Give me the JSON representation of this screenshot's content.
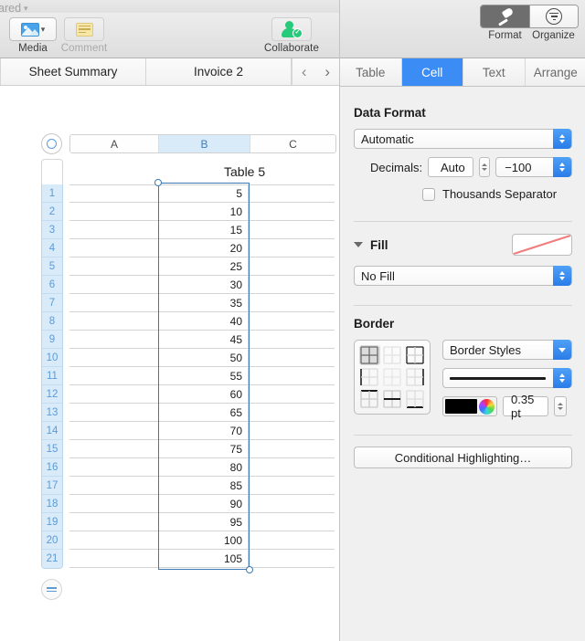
{
  "window": {
    "shared_label": "ared",
    "shared_icon": "chevron-down-icon"
  },
  "toolbar": {
    "items": [
      {
        "label": "Media",
        "icon": "media-image-icon",
        "enabled": true
      },
      {
        "label": "Comment",
        "icon": "comment-note-icon",
        "enabled": false
      },
      {
        "label": "Collaborate",
        "icon": "collaborate-person-check-icon",
        "enabled": true
      }
    ]
  },
  "sheet_tabs": {
    "tabs": [
      "Sheet Summary",
      "Invoice 2"
    ],
    "prev_icon": "chevron-left-icon",
    "next_icon": "chevron-right-icon"
  },
  "canvas": {
    "table_name": "Table 5",
    "columns": [
      "A",
      "B",
      "C"
    ],
    "selected_column": "B",
    "row_numbers": [
      "1",
      "2",
      "3",
      "4",
      "5",
      "6",
      "7",
      "8",
      "9",
      "10",
      "11",
      "12",
      "13",
      "14",
      "15",
      "16",
      "17",
      "18",
      "19",
      "20",
      "21"
    ],
    "column_b_values": [
      "5",
      "10",
      "15",
      "20",
      "25",
      "30",
      "35",
      "40",
      "45",
      "50",
      "55",
      "60",
      "65",
      "70",
      "75",
      "80",
      "85",
      "90",
      "95",
      "100",
      "105"
    ],
    "corner_handle_icon": "table-select-handle-icon",
    "add_rows_handle_icon": "add-rows-handle-icon"
  },
  "inspector": {
    "view_toggle": [
      {
        "label": "Format",
        "icon": "paintbrush-icon",
        "active": true
      },
      {
        "label": "Organize",
        "icon": "organize-filter-icon",
        "active": false
      }
    ],
    "tabs": [
      {
        "label": "Table",
        "active": false
      },
      {
        "label": "Cell",
        "active": true
      },
      {
        "label": "Text",
        "active": false
      },
      {
        "label": "Arrange",
        "active": false
      }
    ],
    "data_format": {
      "title": "Data Format",
      "format_value": "Automatic",
      "decimals_label": "Decimals:",
      "decimals_value": "Auto",
      "negative_value": "−100",
      "thousands_separator_label": "Thousands Separator",
      "thousands_separator_checked": false
    },
    "fill": {
      "title": "Fill",
      "expanded": true,
      "value": "No Fill",
      "swatch": "no-fill-red-slash"
    },
    "border": {
      "title": "Border",
      "patterns": [
        {
          "name": "all-borders",
          "selected": true
        },
        {
          "name": "no-borders",
          "selected": false
        },
        {
          "name": "outer-borders",
          "selected": false
        },
        {
          "name": "left-border",
          "selected": false
        },
        {
          "name": "inner-borders",
          "selected": false
        },
        {
          "name": "right-border",
          "selected": false
        },
        {
          "name": "top-border",
          "selected": false
        },
        {
          "name": "horizontal-inner-border",
          "selected": false
        },
        {
          "name": "bottom-border",
          "selected": false
        }
      ],
      "styles_value": "Border Styles",
      "line_style": "solid-thick-line",
      "color": "#000000",
      "width_value": "0.35 pt"
    },
    "conditional_highlighting_label": "Conditional Highlighting…"
  },
  "colors": {
    "accent_blue": "#3b8cf5",
    "selection_blue": "#3b79b5",
    "header_blue": "#d9eaf9",
    "collab_green": "#25ca7b",
    "no_fill_red": "#f07c7c"
  }
}
